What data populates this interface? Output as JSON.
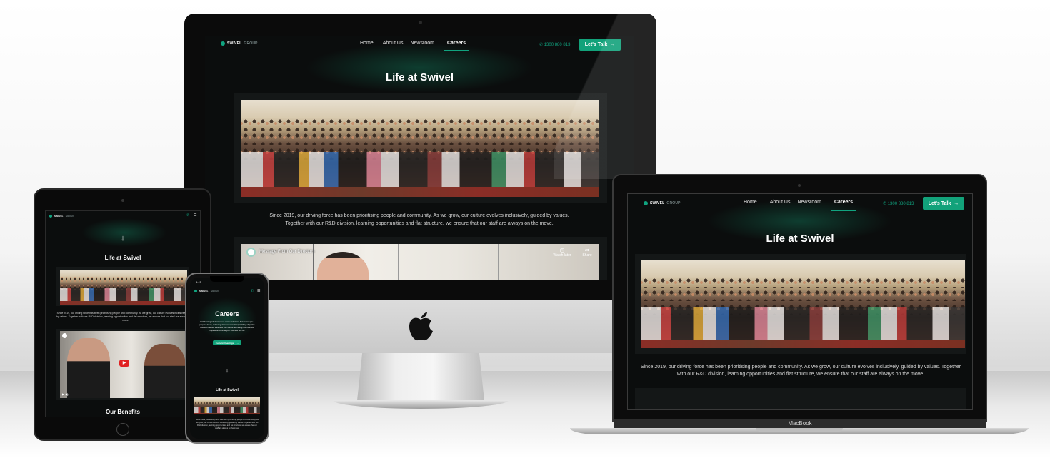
{
  "site": {
    "logo_main": "SWIVEL",
    "logo_sub": "GROUP",
    "nav": [
      "Home",
      "About Us",
      "Newsroom",
      "Careers"
    ],
    "phone": "1300 880 813",
    "cta": "Let's Talk",
    "section_title": "Life at Swivel",
    "body_text": "Since 2019, our driving force has been prioritising people and community. As we grow, our culture evolves inclusively, guided by values. Together with our R&D division, learning opportunities and flat structure, we ensure that our staff are always on the move.",
    "video_title": "Message From Our Directors",
    "video_watch_later": "Watch later",
    "video_share": "Share",
    "benefits_title": "Our Benefits"
  },
  "mobile": {
    "status_time": "9:41",
    "careers_title": "Careers",
    "careers_text": "Collaborating with businesses across industries, Swivel Group is a purpose-driven, technology-focused consultancy building adaptable solutions that are tailored to your unique technology and business requirements. Grow your business with us!",
    "openings_button": "Current Openings"
  },
  "macbook": {
    "label": "MacBook"
  },
  "colors": {
    "accent": "#12a27a",
    "background": "#0b0d0d"
  }
}
